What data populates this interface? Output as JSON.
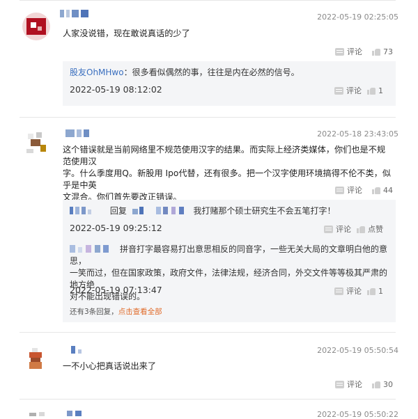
{
  "comments": [
    {
      "time": "2022-05-19 02:25:05",
      "text": "人家没说错，现在敢说真话的少了",
      "comment_label": "评论",
      "likes": "73",
      "replies": [
        {
          "author": "股友OhMHwo",
          "text": "：很多看似偶然的事，往往是内在必然的信号。",
          "time": "2022-05-19 08:12:02",
          "comment_label": "评论",
          "likes": "1"
        }
      ]
    },
    {
      "time": "2022-05-18 23:43:05",
      "text_lines": [
        "这个错误就是当前网络里不规范使用汉字的结果。而实际上经济类媒体，你们也是不规范使用汉",
        "字。什么季度用Q。新股用 Ipo代替，还有很多。把一个汉字使用环境搞得不伦不类，似乎是中英",
        "文混合。你们首先要改正错误。"
      ],
      "comment_label": "评论",
      "likes": "44",
      "replies": [
        {
          "reply_word": "回复",
          "text": "我打赌那个硕士研究生不会五笔打字！",
          "time": "2022-05-19 09:25:12",
          "comment_label": "评论",
          "likes": "点赞"
        },
        {
          "text_lines": [
            "拼音打字最容易打出意思相反的同音字，一些无关大局的文章明白他的意思，",
            "一笑而过，但在国家政策，政府文件，法律法规，经济合同，外交文件等等极其严肃的地方绝",
            "对不能出现错误的。"
          ],
          "time": "2022-05-19 07:13:47",
          "comment_label": "评论",
          "likes": "1"
        }
      ],
      "more_prefix": "还有3条回复，",
      "more_link": "点击查看全部"
    },
    {
      "time": "2022-05-19 05:50:54",
      "text": "一不小心把真话说出来了",
      "comment_label": "评论",
      "likes": "30"
    },
    {
      "time": "2022-05-19 05:50:22"
    }
  ],
  "colors": {
    "link": "#3a6fbf",
    "more_link": "#e06b2a",
    "reply_bg": "#f4f5f7"
  }
}
